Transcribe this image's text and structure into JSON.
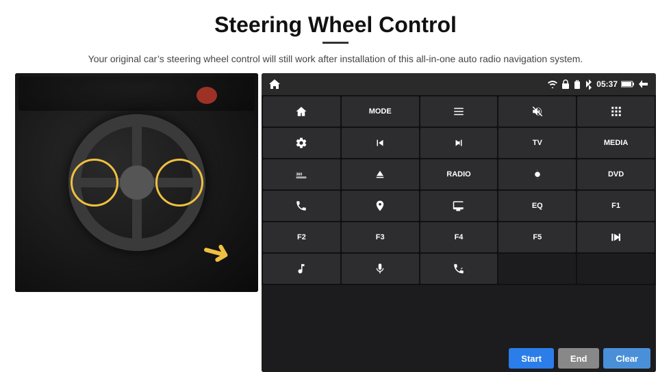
{
  "header": {
    "title": "Steering Wheel Control",
    "divider": true,
    "subtitle": "Your original car’s steering wheel control will still work after installation of this all-in-one auto radio navigation system."
  },
  "panel": {
    "time": "05:37",
    "rows": [
      [
        {
          "type": "icon",
          "icon": "home",
          "label": "home"
        },
        {
          "type": "text",
          "label": "MODE"
        },
        {
          "type": "icon",
          "icon": "list",
          "label": "list"
        },
        {
          "type": "icon",
          "icon": "mute",
          "label": "mute"
        },
        {
          "type": "icon",
          "icon": "apps",
          "label": "apps"
        }
      ],
      [
        {
          "type": "icon",
          "icon": "settings",
          "label": "settings"
        },
        {
          "type": "icon",
          "icon": "prev",
          "label": "prev"
        },
        {
          "type": "icon",
          "icon": "next",
          "label": "next"
        },
        {
          "type": "text",
          "label": "TV"
        },
        {
          "type": "text",
          "label": "MEDIA"
        }
      ],
      [
        {
          "type": "icon",
          "icon": "360cam",
          "label": "360cam"
        },
        {
          "type": "icon",
          "icon": "eject",
          "label": "eject"
        },
        {
          "type": "text",
          "label": "RADIO"
        },
        {
          "type": "icon",
          "icon": "brightness",
          "label": "brightness"
        },
        {
          "type": "text",
          "label": "DVD"
        }
      ],
      [
        {
          "type": "icon",
          "icon": "phone",
          "label": "phone"
        },
        {
          "type": "icon",
          "icon": "nav2",
          "label": "nav"
        },
        {
          "type": "icon",
          "icon": "screen",
          "label": "screen"
        },
        {
          "type": "text",
          "label": "EQ"
        },
        {
          "type": "text",
          "label": "F1"
        }
      ],
      [
        {
          "type": "text",
          "label": "F2"
        },
        {
          "type": "text",
          "label": "F3"
        },
        {
          "type": "text",
          "label": "F4"
        },
        {
          "type": "text",
          "label": "F5"
        },
        {
          "type": "icon",
          "icon": "playpause",
          "label": "playpause"
        }
      ],
      [
        {
          "type": "icon",
          "icon": "music",
          "label": "music"
        },
        {
          "type": "icon",
          "icon": "mic",
          "label": "mic"
        },
        {
          "type": "icon",
          "icon": "volphone",
          "label": "volphone"
        },
        {
          "type": "empty",
          "label": ""
        },
        {
          "type": "empty",
          "label": ""
        }
      ]
    ],
    "buttons": {
      "start": "Start",
      "end": "End",
      "clear": "Clear"
    }
  }
}
